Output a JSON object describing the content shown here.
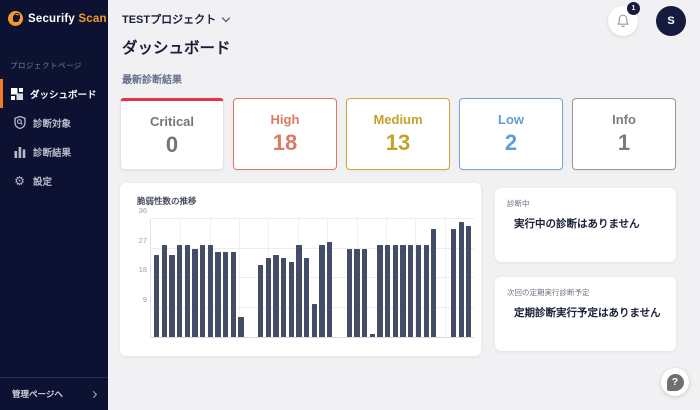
{
  "brand": {
    "name_primary": "Securify",
    "name_secondary": "Scan"
  },
  "topbar": {
    "project_selector": "TESTプロジェクト",
    "notification_count": "1",
    "avatar_initial": "S"
  },
  "page": {
    "title": "ダッシュボード",
    "section_label": "最新診断結果"
  },
  "sidebar": {
    "section_label": "プロジェクトページ",
    "items": [
      {
        "label": "ダッシュボード",
        "icon": "dashboard-icon",
        "active": true
      },
      {
        "label": "診断対象",
        "icon": "scan-target-icon",
        "active": false
      },
      {
        "label": "診断結果",
        "icon": "scan-results-icon",
        "active": false
      },
      {
        "label": "設定",
        "icon": "gear-icon",
        "active": false
      }
    ],
    "footer_link": "管理ページへ"
  },
  "icons": {
    "gear": "⚙",
    "help": "?"
  },
  "severity_cards": [
    {
      "label": "Critical",
      "value": "0",
      "border_color": "#e73249",
      "border_style": "top",
      "text_color": "#72767a"
    },
    {
      "label": "High",
      "value": "18",
      "border_color": "#dc7963",
      "border_style": "full",
      "text_color": "#dc7963"
    },
    {
      "label": "Medium",
      "value": "13",
      "border_color": "#c9a93a",
      "border_style": "full",
      "text_color": "#c2a22b"
    },
    {
      "label": "Low",
      "value": "2",
      "border_color": "#6fa8dc",
      "border_style": "full",
      "text_color": "#5e9ed8"
    },
    {
      "label": "Info",
      "value": "1",
      "border_color": "#97999d",
      "border_style": "full",
      "text_color": "#797d82"
    }
  ],
  "chart_data": {
    "type": "bar",
    "title": "脆弱性数の推移",
    "xlabel": "",
    "ylabel": "",
    "ylim": [
      0,
      36
    ],
    "yticks": [
      9,
      18,
      27,
      36
    ],
    "grid": true,
    "legend": false,
    "bar_color": "#444d68",
    "groups": [
      [
        25,
        28,
        25,
        28,
        28,
        27,
        28,
        28,
        26,
        26,
        26,
        6
      ],
      [
        22,
        24,
        25,
        24,
        23,
        28,
        24,
        10,
        28,
        29
      ],
      [
        27,
        27,
        27,
        1,
        28,
        28,
        28,
        28,
        28,
        28,
        28,
        33
      ],
      [
        33,
        35,
        34
      ]
    ]
  },
  "panels": [
    {
      "label": "診断中",
      "message": "実行中の診断はありません"
    },
    {
      "label": "次回の定期実行診断予定",
      "message": "定期診断実行予定はありません"
    }
  ],
  "help_label": "?"
}
